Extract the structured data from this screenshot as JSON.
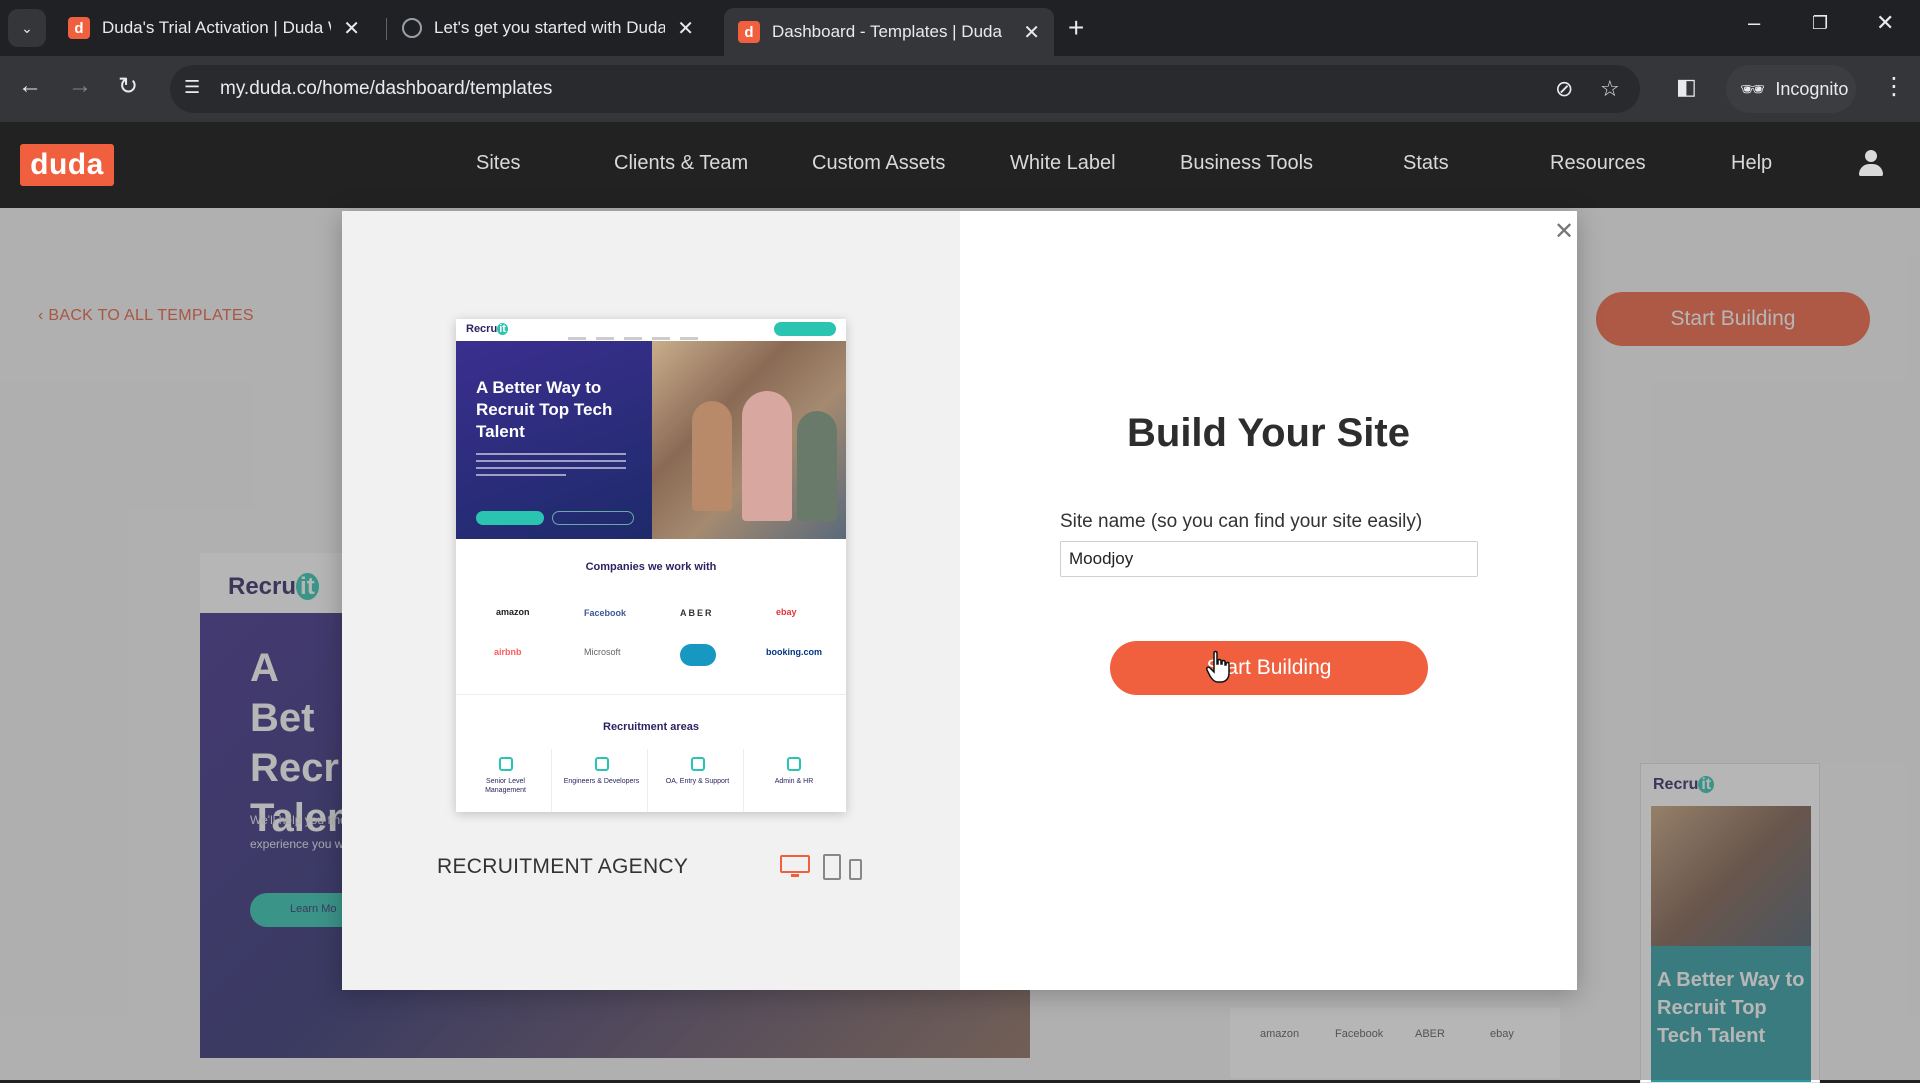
{
  "browser": {
    "tabs": [
      {
        "title": "Duda's Trial Activation | Duda W",
        "icon": "duda-favicon"
      },
      {
        "title": "Let's get you started with Duda",
        "icon": "globe-favicon"
      },
      {
        "title": "Dashboard - Templates | Duda",
        "icon": "duda-favicon",
        "active": true
      }
    ],
    "url": "my.duda.co/home/dashboard/templates",
    "incognito_label": "Incognito"
  },
  "header": {
    "logo": "duda",
    "nav": [
      "Sites",
      "Clients & Team",
      "Custom Assets",
      "White Label",
      "Business Tools",
      "Stats",
      "Resources",
      "Help"
    ]
  },
  "page": {
    "back_link": "BACK TO ALL TEMPLATES",
    "start_button": "Start Building",
    "bg_desktop": {
      "logo_text": "Recru",
      "logo_badge": "it",
      "hero_title": "A Bet Recr Talen",
      "hero_sub": "We'll help you find experience you w",
      "button": "Learn Mo"
    },
    "bg_mobile": {
      "logo_text": "Recru",
      "logo_badge": "it",
      "hero_title": "A Better Way to Recruit Top Tech Talent"
    },
    "bg_logos": [
      "amazon",
      "Facebook",
      "ABER",
      "ebay"
    ]
  },
  "modal": {
    "preview": {
      "logo_text": "Recru",
      "logo_badge": "it",
      "hero_title": "A Better Way to Recruit Top Tech Talent",
      "companies_title": "Companies we work with",
      "company_logos": [
        "amazon",
        "Facebook",
        "ABER",
        "ebay",
        "airbnb",
        "Microsoft",
        "booking.com"
      ],
      "areas_title": "Recruitment areas",
      "areas": [
        "Senior Level Management",
        "Engineers & Developers",
        "OA, Entry & Support",
        "Admin & HR"
      ]
    },
    "template_name": "RECRUITMENT AGENCY",
    "title": "Build Your Site",
    "field_label": "Site name (so you can find your site easily)",
    "site_name_value": "Moodjoy",
    "start_button": "Start Building"
  },
  "colors": {
    "brand": "#f0603f",
    "header_bg": "#222222",
    "accent_teal": "#2bc4b0"
  }
}
